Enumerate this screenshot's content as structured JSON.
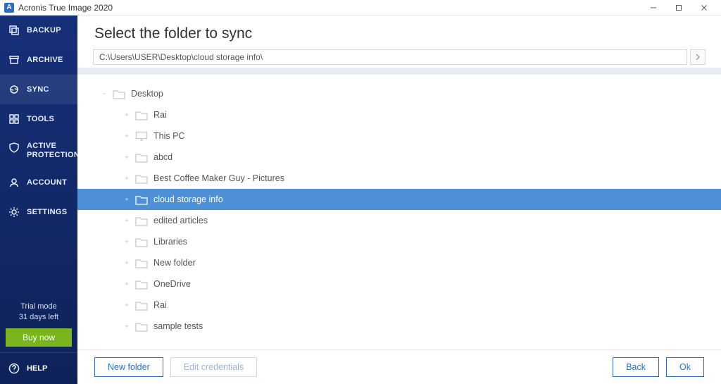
{
  "window": {
    "title": "Acronis True Image 2020"
  },
  "sidebar": {
    "items": [
      {
        "label": "BACKUP"
      },
      {
        "label": "ARCHIVE"
      },
      {
        "label": "SYNC"
      },
      {
        "label": "TOOLS"
      },
      {
        "label_line1": "ACTIVE",
        "label_line2": "PROTECTION"
      },
      {
        "label": "ACCOUNT"
      },
      {
        "label": "SETTINGS"
      }
    ],
    "trial_line1": "Trial mode",
    "trial_line2": "31 days left",
    "buy_now": "Buy now",
    "help": "HELP"
  },
  "page": {
    "title": "Select the folder to sync",
    "path": "C:\\Users\\USER\\Desktop\\cloud storage info\\"
  },
  "tree": {
    "root": {
      "label": "Desktop",
      "expando": "−"
    },
    "children": [
      {
        "label": "Rai",
        "expando": "+"
      },
      {
        "label": "This PC",
        "expando": "+",
        "icon": "monitor"
      },
      {
        "label": "abcd",
        "expando": "+"
      },
      {
        "label": "Best Coffee Maker Guy - Pictures",
        "expando": "+"
      },
      {
        "label": "cloud storage info",
        "expando": "+",
        "selected": true
      },
      {
        "label": "edited articles",
        "expando": "+"
      },
      {
        "label": "Libraries",
        "expando": "+"
      },
      {
        "label": "New folder",
        "expando": "+"
      },
      {
        "label": "OneDrive",
        "expando": "+"
      },
      {
        "label": "Rai",
        "expando": "+"
      },
      {
        "label": "sample tests",
        "expando": "+"
      }
    ]
  },
  "footer": {
    "new_folder": "New folder",
    "edit_credentials": "Edit credentials",
    "back": "Back",
    "ok": "Ok"
  }
}
